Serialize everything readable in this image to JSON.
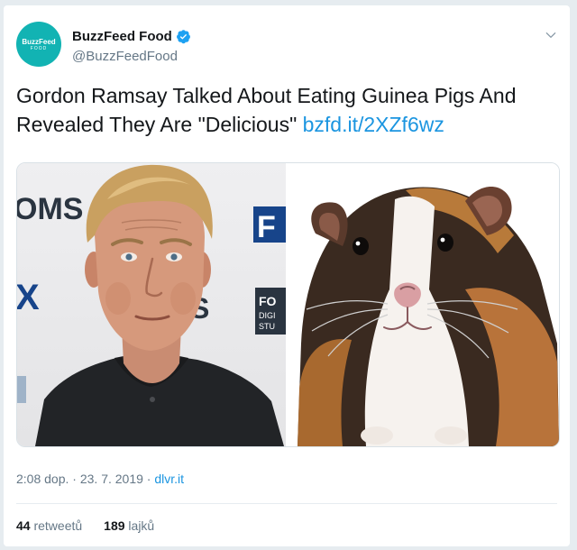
{
  "account": {
    "display_name": "BuzzFeed Food",
    "handle": "@BuzzFeedFood",
    "avatar_brand": "BuzzFeed",
    "avatar_sub": "FOOD",
    "verified": true,
    "brand_color": "#12b3b3"
  },
  "tweet": {
    "text": "Gordon Ramsay Talked About Eating Guinea Pigs And Revealed They Are \"Delicious\" ",
    "link": "bzfd.it/2XZf6wz",
    "link_color": "#1b95e0"
  },
  "media": {
    "left_photo": {
      "icon": "person-photo",
      "backdrop_text_1": "OMS",
      "backdrop_text_2": "X",
      "backdrop_text_3": "S",
      "backdrop_logo_1": "F",
      "backdrop_logo_2": "FO",
      "backdrop_logo_3": "DIGI",
      "backdrop_logo_4": "STU"
    },
    "right_photo": {
      "icon": "guinea-pig-photo"
    }
  },
  "meta": {
    "time": "2:08 dop.",
    "separator": " · ",
    "date": "23. 7. 2019",
    "via": "dlvr.it"
  },
  "stats": {
    "retweets_count": "44",
    "retweets_label": "retweetů",
    "likes_count": "189",
    "likes_label": "lajků"
  }
}
